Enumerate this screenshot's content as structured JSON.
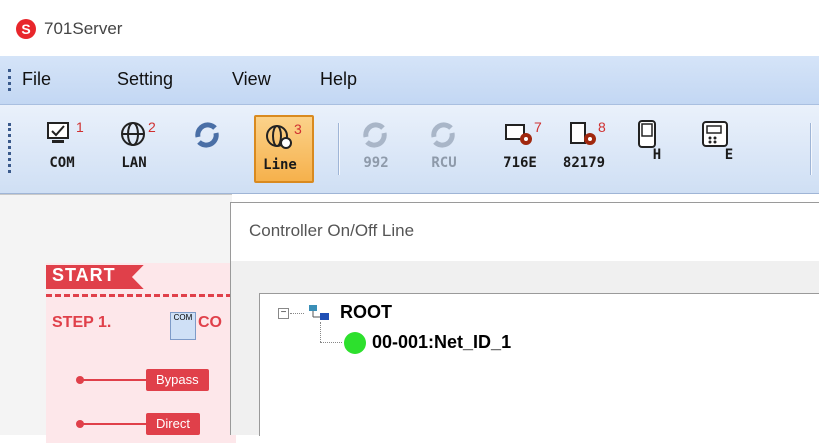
{
  "app": {
    "logo_letter": "S",
    "title": "701Server"
  },
  "menu": [
    "File",
    "Setting",
    "View",
    "Help"
  ],
  "toolbar": {
    "buttons": [
      {
        "icon": "com-monitor-icon",
        "num": "1",
        "label": "COM"
      },
      {
        "icon": "lan-globe-icon",
        "num": "2",
        "label": "LAN"
      },
      {
        "icon": "refresh-icon",
        "num": "",
        "label": ""
      },
      {
        "icon": "line-globe-icon",
        "num": "3",
        "label": "Line"
      },
      {
        "icon": "refresh-icon",
        "num": "",
        "label": "992"
      },
      {
        "icon": "refresh-icon",
        "num": "",
        "label": "RCU"
      },
      {
        "icon": "gear-device-icon",
        "num": "7",
        "label": "716E"
      },
      {
        "icon": "gear-device-icon",
        "num": "8",
        "label": "82179"
      },
      {
        "icon": "device-h-icon",
        "num": "",
        "label": "H"
      },
      {
        "icon": "device-e-icon",
        "num": "",
        "label": "E"
      }
    ]
  },
  "left_panel": {
    "start": "START",
    "step1": "STEP 1.",
    "step1_icon_text": "COM",
    "step1_cut": "CO",
    "options": [
      "Bypass",
      "Direct"
    ]
  },
  "dialog": {
    "title": "Controller On/Off Line",
    "tree": {
      "expander": "−",
      "root": "ROOT",
      "children": [
        "00-001:Net_ID_1"
      ]
    }
  },
  "colors": {
    "accent_red": "#e0404a",
    "online": "#2de02d",
    "active_button": "#f6b14c"
  }
}
